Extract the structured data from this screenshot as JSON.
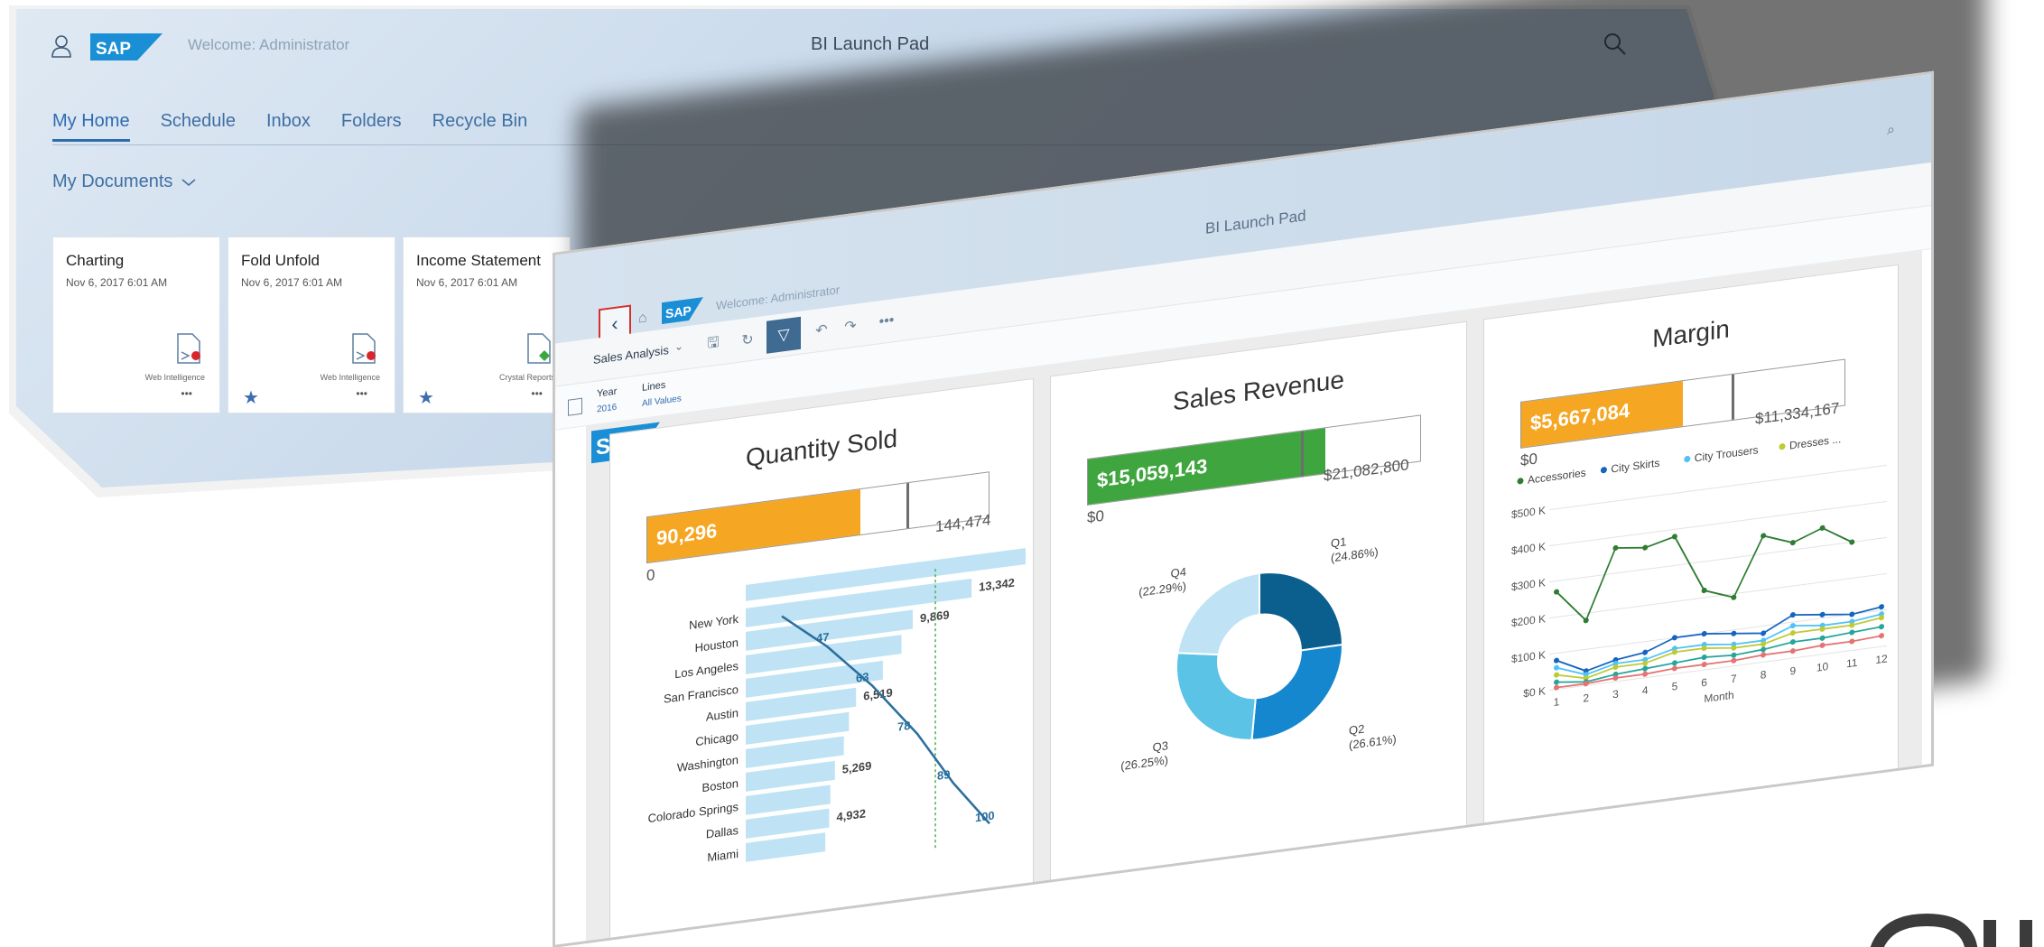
{
  "launchpad": {
    "welcome": "Welcome: Administrator",
    "title": "BI Launch Pad",
    "tabs": [
      "My Home",
      "Schedule",
      "Inbox",
      "Folders",
      "Recycle Bin"
    ],
    "active_tab": "My Home",
    "section": "My Documents",
    "tiles": [
      {
        "name": "Charting",
        "date": "Nov 6, 2017 6:01 AM",
        "type": "Web Intelligence",
        "more": "•••",
        "favorite": false
      },
      {
        "name": "Fold Unfold",
        "date": "Nov 6, 2017 6:01 AM",
        "type": "Web Intelligence",
        "more": "•••",
        "favorite": true
      },
      {
        "name": "Income Statement",
        "date": "Nov 6, 2017 6:01 AM",
        "type": "Crystal Reports",
        "more": "•••",
        "favorite": true
      }
    ]
  },
  "document": {
    "launchpad_title": "BI Launch Pad",
    "welcome": "Welcome: Administrator",
    "name": "Sales Analysis",
    "filters": [
      {
        "label": "Year",
        "value": "2016"
      },
      {
        "label": "Lines",
        "value": "All Values"
      }
    ],
    "colors": {
      "orange": "#f5a623",
      "green": "#3fa63f",
      "blue_dark": "#0a5f8e",
      "blue": "#1587cf",
      "blue_mid": "#5bc3e6",
      "blue_light": "#bfe3f4",
      "toolbar_active": "#3f6a91",
      "back_border": "#d2322d"
    }
  },
  "chart_data": [
    {
      "type": "bar",
      "title": "Quantity Sold",
      "kpi": {
        "value": "90,296",
        "value_num": 90296,
        "target": 144474,
        "target_label": "144,474",
        "min_label": "0",
        "marker_fraction": 0.76
      },
      "categories": [
        "New York",
        "Houston",
        "Los Angeles",
        "San Francisco",
        "Austin",
        "Chicago",
        "Washington",
        "Boston",
        "Colorado Springs",
        "Dallas",
        "Miami"
      ],
      "values": [
        13342,
        9869,
        null,
        null,
        6519,
        null,
        null,
        5269,
        null,
        4932,
        null
      ],
      "data_labels": [
        "13,342",
        "9,869",
        "",
        "",
        "6,519",
        "",
        "",
        "5,269",
        "",
        "4,932",
        ""
      ],
      "cumulative_labels": [
        "47",
        "63",
        "78",
        "89",
        "100"
      ]
    },
    {
      "type": "pie",
      "title": "Sales Revenue",
      "kpi": {
        "value": "$15,059,143",
        "value_num": 15059143,
        "target": 21082800,
        "target_label": "$21,082,800",
        "min_label": "$0",
        "marker_fraction": 0.64
      },
      "slices": [
        {
          "label": "Q1",
          "pct_label": "(24.86%)",
          "value": 24.86,
          "color": "#0a5f8e"
        },
        {
          "label": "Q2",
          "pct_label": "(26.61%)",
          "value": 26.61,
          "color": "#1587cf"
        },
        {
          "label": "Q3",
          "pct_label": "(26.25%)",
          "value": 26.25,
          "color": "#5bc3e6"
        },
        {
          "label": "Q4",
          "pct_label": "(22.29%)",
          "value": 22.29,
          "color": "#bfe3f4"
        }
      ]
    },
    {
      "type": "line",
      "title": "Margin",
      "kpi": {
        "value": "$5,667,084",
        "value_num": 5667084,
        "target": 11334167,
        "target_label": "$11,334,167",
        "min_label": "$0",
        "marker_fraction": 0.65
      },
      "legend": [
        "Accessories",
        "City Skirts",
        "City Trousers",
        "Dresses ..."
      ],
      "xlabel": "Month",
      "x": [
        1,
        2,
        3,
        4,
        5,
        6,
        7,
        8,
        9,
        10,
        11,
        12
      ],
      "y_ticks": [
        "$0 K",
        "$100 K",
        "$200 K",
        "$300 K",
        "$400 K",
        "$500 K"
      ],
      "ylim": [
        0,
        500
      ],
      "series": [
        {
          "name": "Accessories",
          "color": "#2e7d32",
          "values": [
            270,
            180,
            370,
            360,
            380,
            220,
            190,
            350,
            320,
            350,
            300,
            null
          ]
        },
        {
          "name": "City Skirts",
          "color": "#1565c0",
          "values": [
            80,
            40,
            60,
            70,
            100,
            100,
            90,
            80,
            120,
            110,
            100,
            110
          ]
        },
        {
          "name": "City Trousers",
          "color": "#4fc3f7",
          "values": [
            60,
            30,
            50,
            50,
            70,
            70,
            60,
            60,
            90,
            80,
            80,
            90
          ]
        },
        {
          "name": "Dresses ...",
          "color": "#c0ca33",
          "values": [
            40,
            20,
            40,
            40,
            60,
            60,
            50,
            50,
            70,
            70,
            70,
            80
          ]
        },
        {
          "name": "",
          "color": "#26a69a",
          "values": [
            20,
            10,
            20,
            25,
            30,
            35,
            30,
            35,
            45,
            45,
            50,
            55
          ]
        },
        {
          "name": "",
          "color": "#e57373",
          "values": [
            5,
            5,
            10,
            10,
            15,
            15,
            15,
            20,
            20,
            25,
            25,
            30
          ]
        }
      ]
    }
  ]
}
